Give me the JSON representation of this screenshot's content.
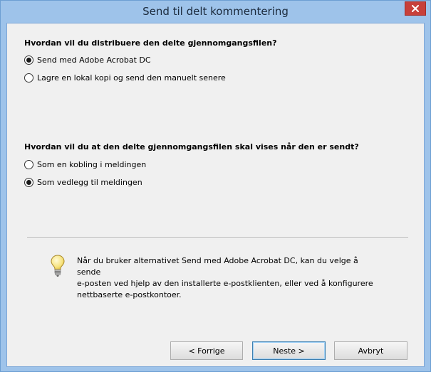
{
  "window": {
    "title": "Send til delt kommentering",
    "close_icon": "close-icon"
  },
  "question1": {
    "title": "Hvordan vil du distribuere den delte gjennomgangsfilen?",
    "options": [
      {
        "label": "Send med Adobe Acrobat DC",
        "checked": true
      },
      {
        "label": "Lagre en lokal kopi og send den manuelt senere",
        "checked": false
      }
    ]
  },
  "question2": {
    "title": "Hvordan vil du at den delte gjennomgangsfilen skal vises når den er sendt?",
    "options": [
      {
        "label": "Som en kobling i meldingen",
        "checked": false
      },
      {
        "label": "Som vedlegg til meldingen",
        "checked": true
      }
    ]
  },
  "tip": {
    "icon": "lightbulb-icon",
    "lines": [
      "Når du bruker alternativet Send med Adobe Acrobat DC, kan du velge å sende",
      "e-posten ved hjelp av den installerte e-postklienten, eller ved å konfigurere",
      "nettbaserte e-postkontoer."
    ]
  },
  "buttons": {
    "back": "< Forrige",
    "next": "Neste >",
    "cancel": "Avbryt"
  },
  "colors": {
    "frame": "#9ec3ea",
    "close": "#c7403a",
    "dialog_bg": "#f0f0f0"
  }
}
